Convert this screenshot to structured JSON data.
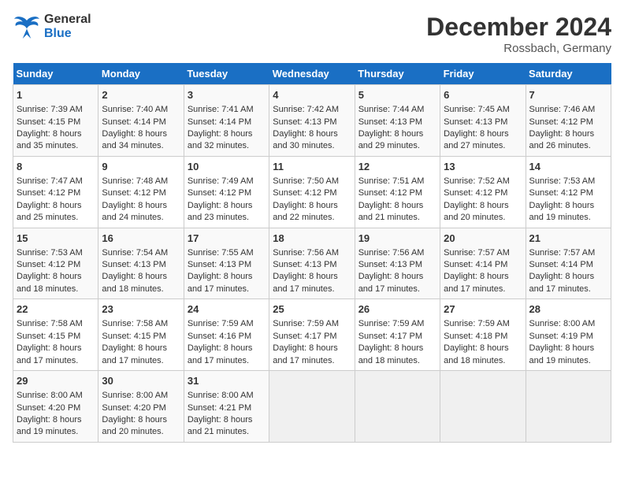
{
  "header": {
    "logo_line1": "General",
    "logo_line2": "Blue",
    "month": "December 2024",
    "location": "Rossbach, Germany"
  },
  "days_of_week": [
    "Sunday",
    "Monday",
    "Tuesday",
    "Wednesday",
    "Thursday",
    "Friday",
    "Saturday"
  ],
  "weeks": [
    [
      {
        "day": "1",
        "sunrise": "7:39 AM",
        "sunset": "4:15 PM",
        "daylight": "8 hours and 35 minutes."
      },
      {
        "day": "2",
        "sunrise": "7:40 AM",
        "sunset": "4:14 PM",
        "daylight": "8 hours and 34 minutes."
      },
      {
        "day": "3",
        "sunrise": "7:41 AM",
        "sunset": "4:14 PM",
        "daylight": "8 hours and 32 minutes."
      },
      {
        "day": "4",
        "sunrise": "7:42 AM",
        "sunset": "4:13 PM",
        "daylight": "8 hours and 30 minutes."
      },
      {
        "day": "5",
        "sunrise": "7:44 AM",
        "sunset": "4:13 PM",
        "daylight": "8 hours and 29 minutes."
      },
      {
        "day": "6",
        "sunrise": "7:45 AM",
        "sunset": "4:13 PM",
        "daylight": "8 hours and 27 minutes."
      },
      {
        "day": "7",
        "sunrise": "7:46 AM",
        "sunset": "4:12 PM",
        "daylight": "8 hours and 26 minutes."
      }
    ],
    [
      {
        "day": "8",
        "sunrise": "7:47 AM",
        "sunset": "4:12 PM",
        "daylight": "8 hours and 25 minutes."
      },
      {
        "day": "9",
        "sunrise": "7:48 AM",
        "sunset": "4:12 PM",
        "daylight": "8 hours and 24 minutes."
      },
      {
        "day": "10",
        "sunrise": "7:49 AM",
        "sunset": "4:12 PM",
        "daylight": "8 hours and 23 minutes."
      },
      {
        "day": "11",
        "sunrise": "7:50 AM",
        "sunset": "4:12 PM",
        "daylight": "8 hours and 22 minutes."
      },
      {
        "day": "12",
        "sunrise": "7:51 AM",
        "sunset": "4:12 PM",
        "daylight": "8 hours and 21 minutes."
      },
      {
        "day": "13",
        "sunrise": "7:52 AM",
        "sunset": "4:12 PM",
        "daylight": "8 hours and 20 minutes."
      },
      {
        "day": "14",
        "sunrise": "7:53 AM",
        "sunset": "4:12 PM",
        "daylight": "8 hours and 19 minutes."
      }
    ],
    [
      {
        "day": "15",
        "sunrise": "7:53 AM",
        "sunset": "4:12 PM",
        "daylight": "8 hours and 18 minutes."
      },
      {
        "day": "16",
        "sunrise": "7:54 AM",
        "sunset": "4:13 PM",
        "daylight": "8 hours and 18 minutes."
      },
      {
        "day": "17",
        "sunrise": "7:55 AM",
        "sunset": "4:13 PM",
        "daylight": "8 hours and 17 minutes."
      },
      {
        "day": "18",
        "sunrise": "7:56 AM",
        "sunset": "4:13 PM",
        "daylight": "8 hours and 17 minutes."
      },
      {
        "day": "19",
        "sunrise": "7:56 AM",
        "sunset": "4:13 PM",
        "daylight": "8 hours and 17 minutes."
      },
      {
        "day": "20",
        "sunrise": "7:57 AM",
        "sunset": "4:14 PM",
        "daylight": "8 hours and 17 minutes."
      },
      {
        "day": "21",
        "sunrise": "7:57 AM",
        "sunset": "4:14 PM",
        "daylight": "8 hours and 17 minutes."
      }
    ],
    [
      {
        "day": "22",
        "sunrise": "7:58 AM",
        "sunset": "4:15 PM",
        "daylight": "8 hours and 17 minutes."
      },
      {
        "day": "23",
        "sunrise": "7:58 AM",
        "sunset": "4:15 PM",
        "daylight": "8 hours and 17 minutes."
      },
      {
        "day": "24",
        "sunrise": "7:59 AM",
        "sunset": "4:16 PM",
        "daylight": "8 hours and 17 minutes."
      },
      {
        "day": "25",
        "sunrise": "7:59 AM",
        "sunset": "4:17 PM",
        "daylight": "8 hours and 17 minutes."
      },
      {
        "day": "26",
        "sunrise": "7:59 AM",
        "sunset": "4:17 PM",
        "daylight": "8 hours and 18 minutes."
      },
      {
        "day": "27",
        "sunrise": "7:59 AM",
        "sunset": "4:18 PM",
        "daylight": "8 hours and 18 minutes."
      },
      {
        "day": "28",
        "sunrise": "8:00 AM",
        "sunset": "4:19 PM",
        "daylight": "8 hours and 19 minutes."
      }
    ],
    [
      {
        "day": "29",
        "sunrise": "8:00 AM",
        "sunset": "4:20 PM",
        "daylight": "8 hours and 19 minutes."
      },
      {
        "day": "30",
        "sunrise": "8:00 AM",
        "sunset": "4:20 PM",
        "daylight": "8 hours and 20 minutes."
      },
      {
        "day": "31",
        "sunrise": "8:00 AM",
        "sunset": "4:21 PM",
        "daylight": "8 hours and 21 minutes."
      },
      null,
      null,
      null,
      null
    ]
  ]
}
